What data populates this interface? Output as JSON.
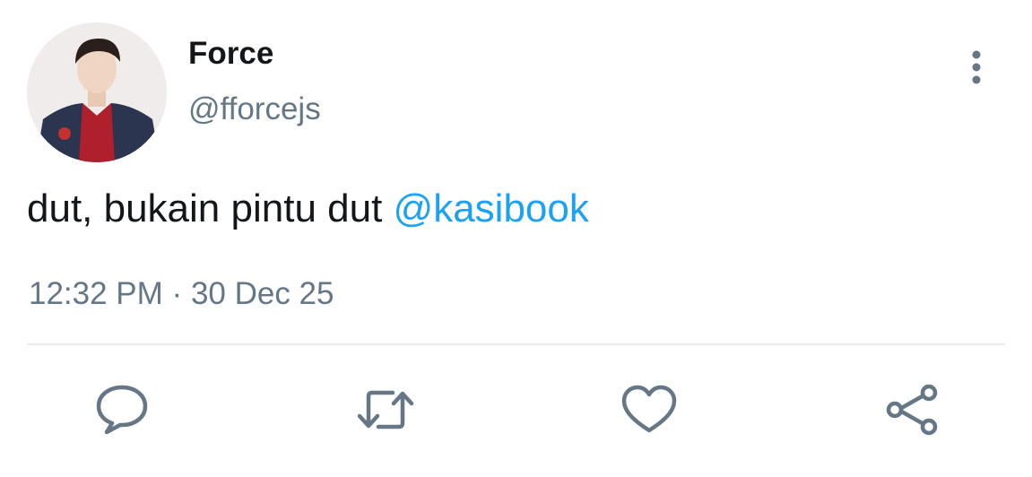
{
  "tweet": {
    "author": {
      "display_name": "Force",
      "handle": "@fforcejs"
    },
    "text": "dut, bukain pintu dut ",
    "mention": "@kasibook",
    "time": "12:32 PM",
    "separator": "·",
    "date": "30 Dec 25"
  },
  "icons": {
    "more": "more-vertical-icon",
    "reply": "reply-icon",
    "retweet": "retweet-icon",
    "like": "heart-icon",
    "share": "share-icon"
  },
  "colors": {
    "text_primary": "#14171a",
    "text_secondary": "#657786",
    "link": "#1da1f2",
    "divider": "#e6ecf0"
  }
}
